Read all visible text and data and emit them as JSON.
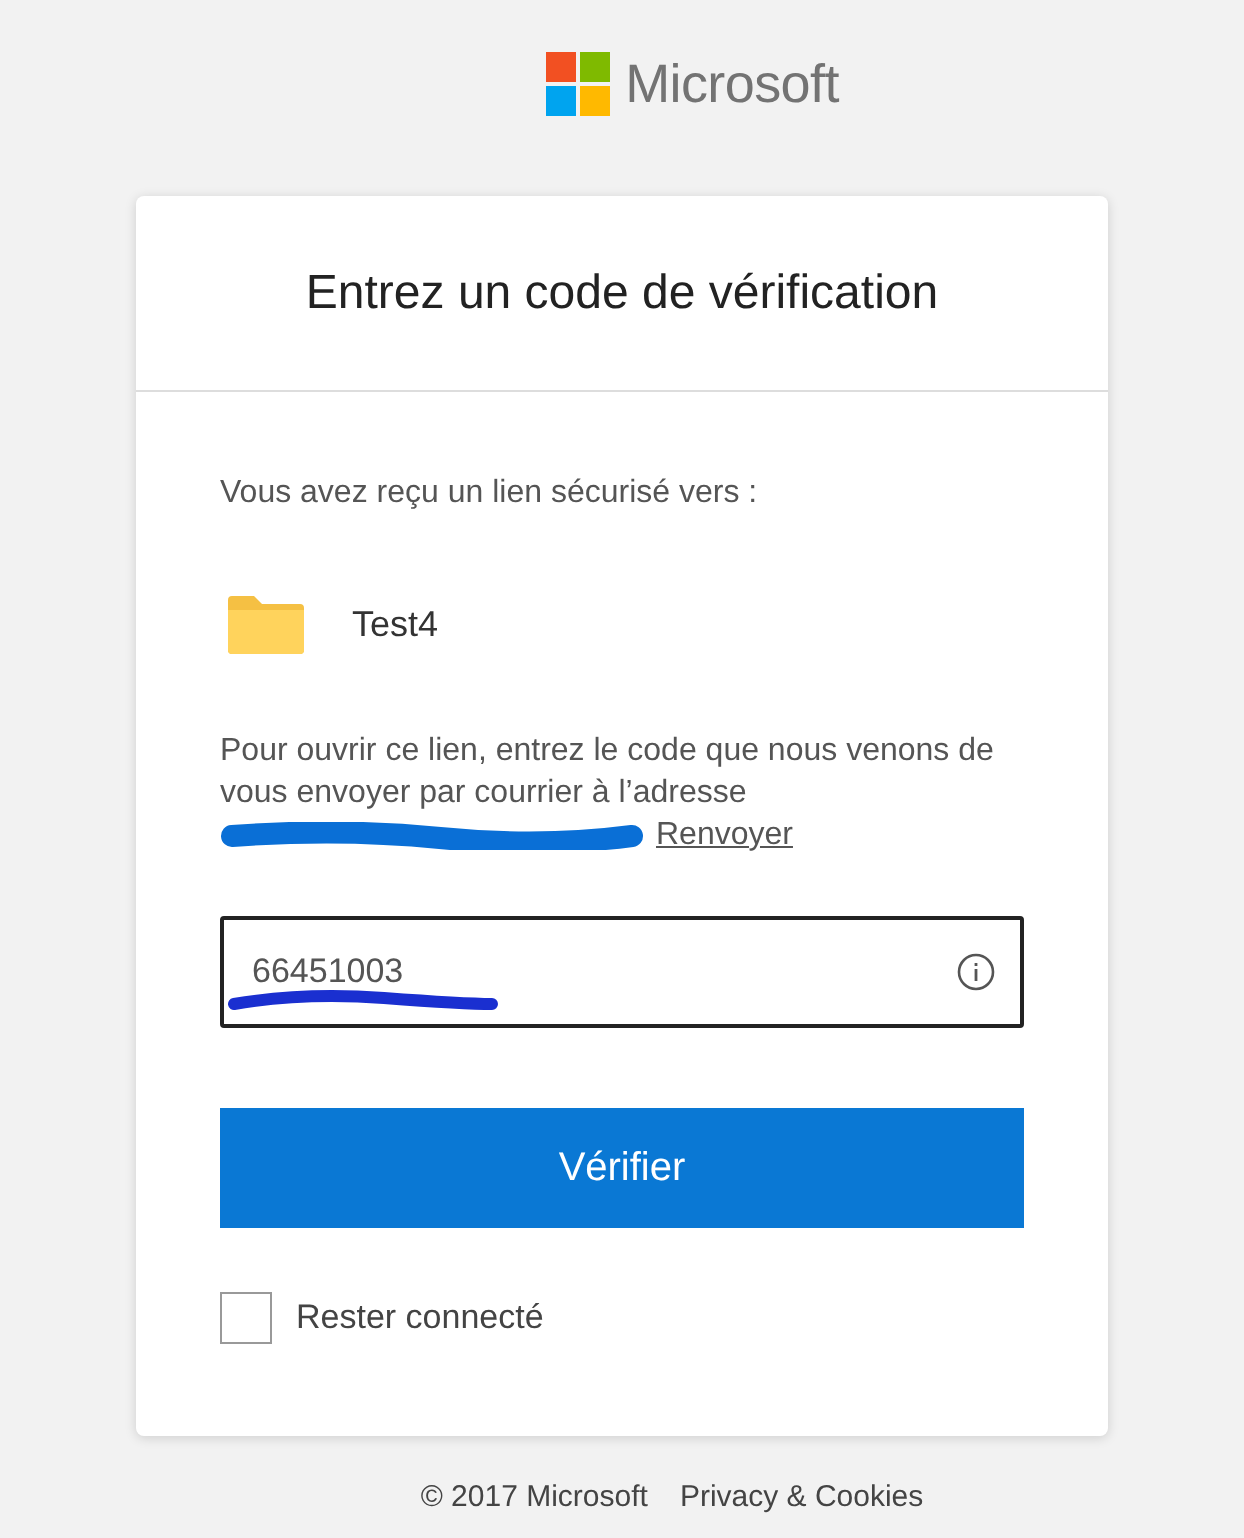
{
  "brand": {
    "name": "Microsoft"
  },
  "card": {
    "title": "Entrez un code de vérification",
    "intro": "Vous avez reçu un lien sécurisé vers :",
    "item": {
      "kind": "folder",
      "name": "Test4"
    },
    "instructions": "Pour ouvrir ce lien, entrez le code que nous venons de vous envoyer par courrier à l’adresse",
    "resend_link": "Renvoyer",
    "code_field": {
      "value": "66451003"
    },
    "submit_button": "Vérifier",
    "remember": {
      "label": "Rester connecté",
      "checked": false
    }
  },
  "footer": {
    "copyright": "© 2017 Microsoft",
    "links": [
      "Privacy & Cookies"
    ]
  }
}
